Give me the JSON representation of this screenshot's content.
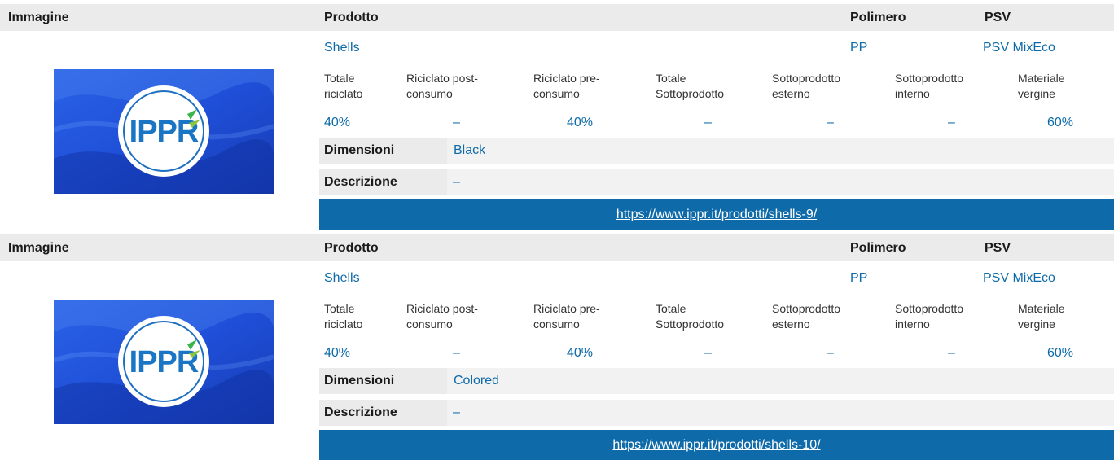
{
  "headers": {
    "image": "Immagine",
    "product": "Prodotto",
    "polymer": "Polimero",
    "psv": "PSV"
  },
  "composition_headers": [
    [
      "Totale",
      "riciclato"
    ],
    [
      "Riciclato post-",
      "consumo"
    ],
    [
      "Riciclato pre-",
      "consumo"
    ],
    [
      "Totale",
      "Sottoprodotto"
    ],
    [
      "Sottoprodotto",
      "esterno"
    ],
    [
      "Sottoprodotto",
      "interno"
    ],
    [
      "Materiale",
      "vergine"
    ]
  ],
  "labels": {
    "dimensions": "Dimensioni",
    "description": "Descrizione"
  },
  "products": [
    {
      "name": "Shells",
      "polymer": "PP",
      "psv": "PSV MixEco",
      "composition": [
        "40%",
        "–",
        "40%",
        "–",
        "–",
        "–",
        "60%"
      ],
      "dimensions": "Black",
      "description": "–",
      "url": "https://www.ippr.it/prodotti/shells-9/",
      "logo_text": "IPPR"
    },
    {
      "name": "Shells",
      "polymer": "PP",
      "psv": "PSV MixEco",
      "composition": [
        "40%",
        "–",
        "40%",
        "–",
        "–",
        "–",
        "60%"
      ],
      "dimensions": "Colored",
      "description": "–",
      "url": "https://www.ippr.it/prodotti/shells-10/",
      "logo_text": "IPPR"
    }
  ],
  "colors": {
    "link": "#0e6aa8",
    "url_bar": "#0e6aa8",
    "header_bg": "#ebebeb",
    "image_bg": "#1f4fd8"
  }
}
